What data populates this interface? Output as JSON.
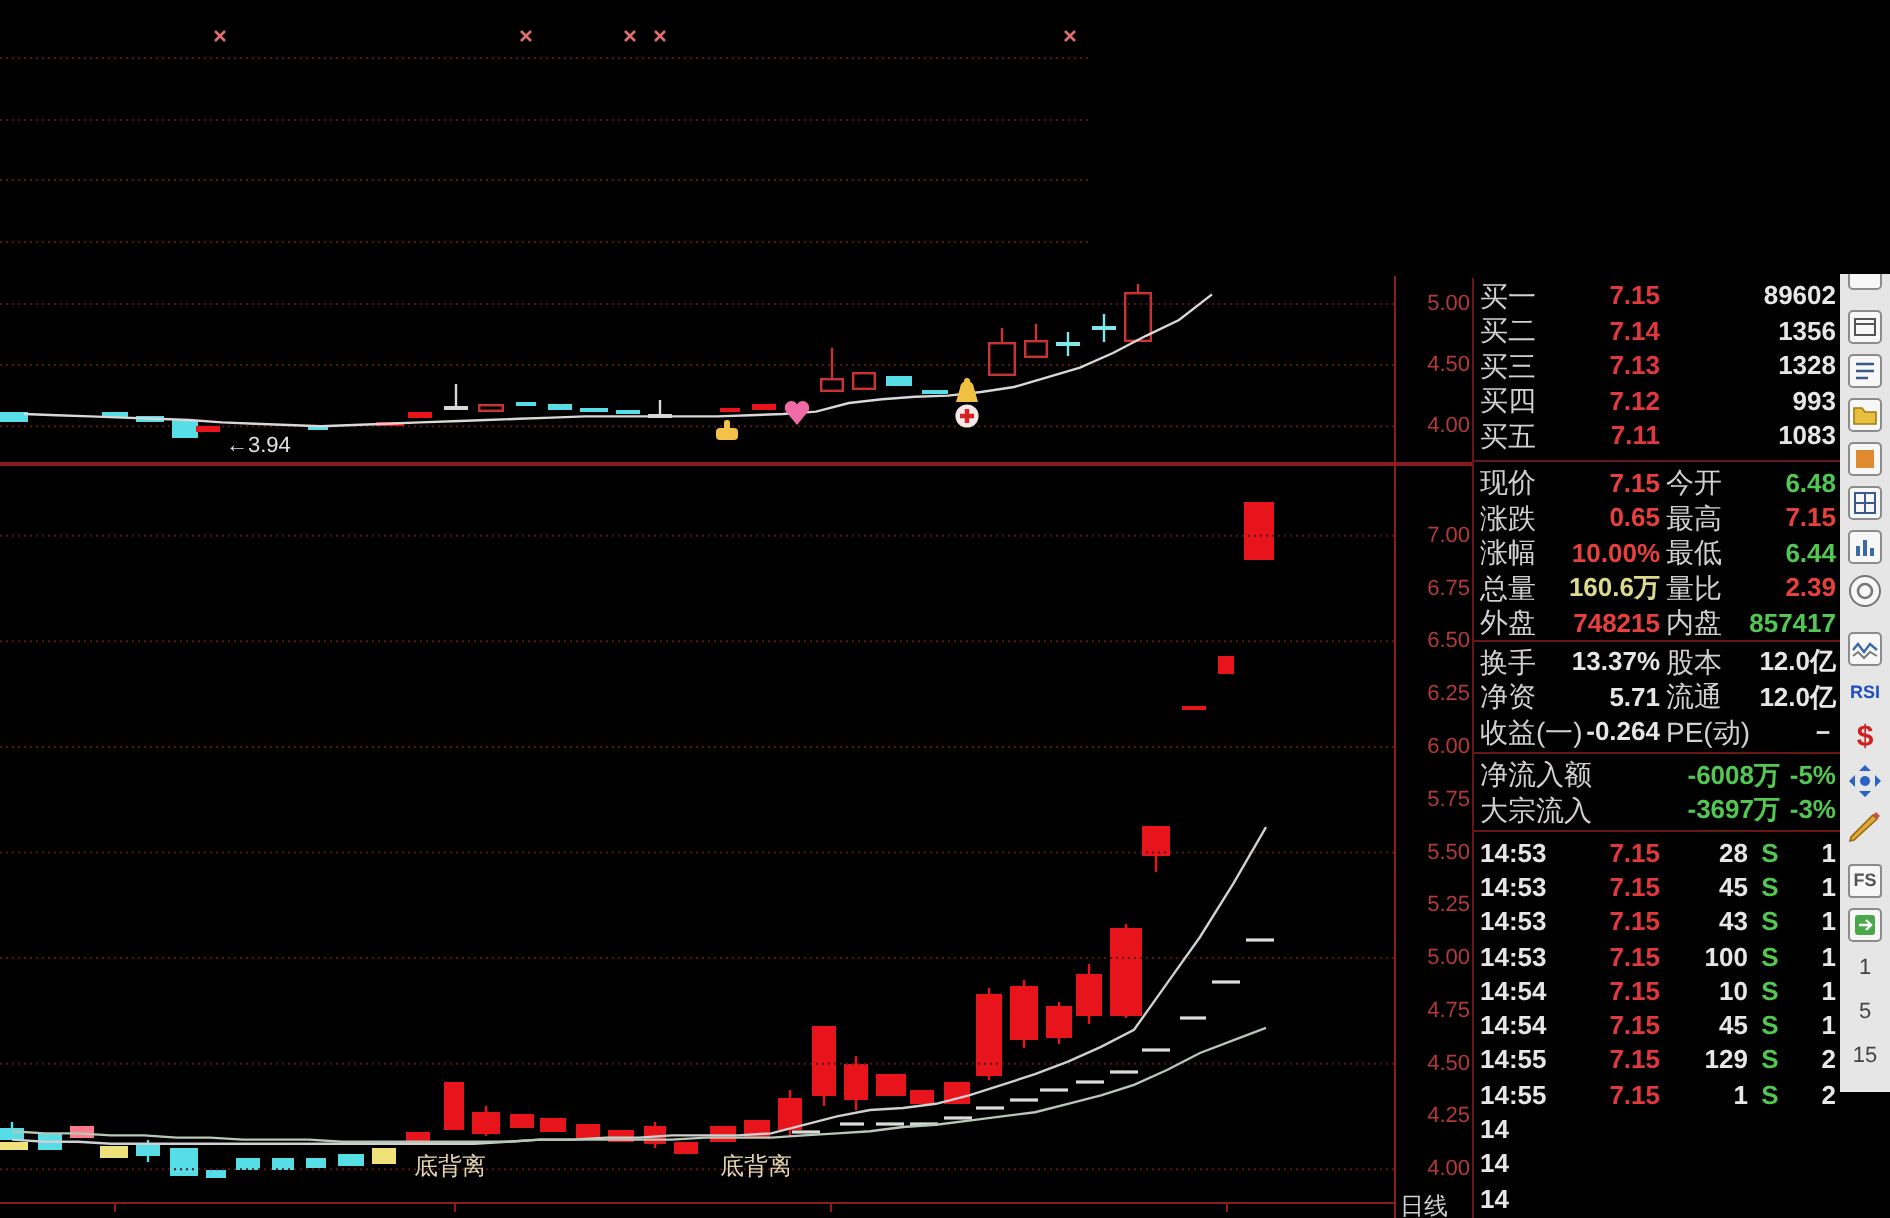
{
  "upper_chart": {
    "chart_data": {
      "type": "line",
      "ylim": [
        3.69,
        5.23
      ],
      "yticks": [
        {
          "value": 5,
          "label": "5.00"
        },
        {
          "value": 4.5,
          "label": "4.50"
        },
        {
          "value": 4,
          "label": "4.00"
        }
      ],
      "grid": true,
      "series": [
        {
          "color": "#d8d8d8",
          "values": [
            4.1,
            4.09,
            4.08,
            4.07,
            4.06,
            4.05,
            4.03,
            4.02,
            4.01,
            4.0,
            4.01,
            4.02,
            4.03,
            4.04,
            4.05,
            4.06,
            4.07,
            4.08,
            4.08,
            4.08,
            4.08,
            4.08,
            4.09,
            4.1,
            4.12,
            4.19,
            4.22,
            4.24,
            4.25,
            4.28,
            4.32,
            4.4,
            4.48,
            4.6,
            4.74,
            4.87,
            5.08
          ]
        }
      ]
    },
    "price_tag": "←3.94"
  },
  "lower_chart": {
    "chart_data": {
      "type": "line",
      "ylim": [
        3.84,
        7.34
      ],
      "yticks": [
        {
          "value": 7,
          "label": "7.00"
        },
        {
          "value": 6.75,
          "label": "6.75"
        },
        {
          "value": 6.5,
          "label": "6.50"
        },
        {
          "value": 6.25,
          "label": "6.25"
        },
        {
          "value": 6,
          "label": "6.00"
        },
        {
          "value": 5.75,
          "label": "5.75"
        },
        {
          "value": 5.5,
          "label": "5.50"
        },
        {
          "value": 5.25,
          "label": "5.25"
        },
        {
          "value": 5,
          "label": "5.00"
        },
        {
          "value": 4.75,
          "label": "4.75"
        },
        {
          "value": 4.5,
          "label": "4.50"
        },
        {
          "value": 4.25,
          "label": "4.25"
        },
        {
          "value": 4,
          "label": "4.00"
        }
      ],
      "grid": true,
      "series": [
        {
          "color": "#d0d0d0",
          "values": [
            4.14,
            4.13,
            4.13,
            4.12,
            4.12,
            4.12,
            4.12,
            4.12,
            4.12,
            4.12,
            4.12,
            4.12,
            4.12,
            4.12,
            4.12,
            4.13,
            4.14,
            4.14,
            4.15,
            4.15,
            4.16,
            4.16,
            4.16,
            4.17,
            4.21,
            4.25,
            4.28,
            4.29,
            4.31,
            4.35,
            4.4,
            4.45,
            4.51,
            4.58,
            4.66,
            4.88,
            5.1,
            5.35,
            5.62
          ]
        },
        {
          "color": "#b8c8b8",
          "values": [
            4.18,
            4.17,
            4.17,
            4.16,
            4.16,
            4.15,
            4.15,
            4.14,
            4.14,
            4.14,
            4.13,
            4.13,
            4.13,
            4.13,
            4.13,
            4.13,
            4.14,
            4.14,
            4.14,
            4.14,
            4.14,
            4.15,
            4.15,
            4.15,
            4.16,
            4.17,
            4.18,
            4.2,
            4.21,
            4.23,
            4.25,
            4.27,
            4.31,
            4.35,
            4.4,
            4.47,
            4.55,
            4.61,
            4.67
          ]
        }
      ]
    },
    "signal_labels": [
      "底背离",
      "底背离"
    ],
    "period": "日线"
  },
  "order_book": [
    {
      "label": "买一",
      "price": "7.15",
      "volume": "89602"
    },
    {
      "label": "买二",
      "price": "7.14",
      "volume": "1356"
    },
    {
      "label": "买三",
      "price": "7.13",
      "volume": "1328"
    },
    {
      "label": "买四",
      "price": "7.12",
      "volume": "993"
    },
    {
      "label": "买五",
      "price": "7.11",
      "volume": "1083"
    }
  ],
  "stats": [
    [
      {
        "label": "现价",
        "value": "7.15",
        "color": "#e8403c"
      },
      {
        "label": "今开",
        "value": "6.48",
        "color": "#52c852"
      }
    ],
    [
      {
        "label": "涨跌",
        "value": "0.65",
        "color": "#e8403c"
      },
      {
        "label": "最高",
        "value": "7.15",
        "color": "#e8403c"
      }
    ],
    [
      {
        "label": "涨幅",
        "value": "10.00%",
        "color": "#e8403c"
      },
      {
        "label": "最低",
        "value": "6.44",
        "color": "#52c852"
      }
    ],
    [
      {
        "label": "总量",
        "value": "160.6万",
        "color": "#dcd88c"
      },
      {
        "label": "量比",
        "value": "2.39",
        "color": "#e8403c"
      }
    ],
    [
      {
        "label": "外盘",
        "value": "748215",
        "color": "#e8403c"
      },
      {
        "label": "内盘",
        "value": "857417",
        "color": "#52c852"
      }
    ]
  ],
  "fundamentals": [
    [
      {
        "label": "换手",
        "value": "13.37%"
      },
      {
        "label": "股本",
        "value": "12.0亿"
      }
    ],
    [
      {
        "label": "净资",
        "value": "5.71"
      },
      {
        "label": "流通",
        "value": "12.0亿"
      }
    ],
    [
      {
        "label": "收益(一)",
        "value": "-0.264"
      },
      {
        "label": "PE(动)",
        "value": "－"
      }
    ]
  ],
  "fund_flows": [
    {
      "label": "净流入额",
      "amount": "-6008万",
      "percent": "-5%"
    },
    {
      "label": "大宗流入",
      "amount": "-3697万",
      "percent": "-3%"
    }
  ],
  "trades": [
    {
      "time": "14:53",
      "price": "7.15",
      "volume": "28",
      "side": "S",
      "count": "1"
    },
    {
      "time": "14:53",
      "price": "7.15",
      "volume": "45",
      "side": "S",
      "count": "1"
    },
    {
      "time": "14:53",
      "price": "7.15",
      "volume": "43",
      "side": "S",
      "count": "1"
    },
    {
      "time": "14:53",
      "price": "7.15",
      "volume": "100",
      "side": "S",
      "count": "1"
    },
    {
      "time": "14:54",
      "price": "7.15",
      "volume": "10",
      "side": "S",
      "count": "1"
    },
    {
      "time": "14:54",
      "price": "7.15",
      "volume": "45",
      "side": "S",
      "count": "1"
    },
    {
      "time": "14:55",
      "price": "7.15",
      "volume": "129",
      "side": "S",
      "count": "2"
    },
    {
      "time": "14:55",
      "price": "7.15",
      "volume": "1",
      "side": "S",
      "count": "2"
    },
    {
      "time": "14"
    },
    {
      "time": "14"
    },
    {
      "time": "14"
    }
  ],
  "toolbar": {
    "labels": [
      "RSI",
      "$",
      "FS"
    ],
    "periods": [
      "1",
      "5",
      "15"
    ]
  }
}
